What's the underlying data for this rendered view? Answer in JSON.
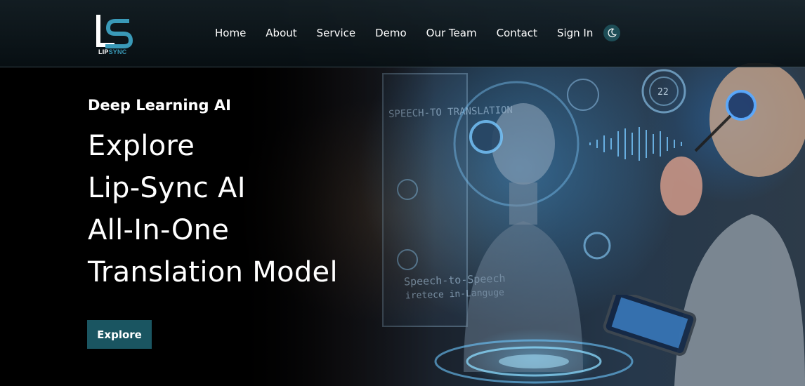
{
  "brand": {
    "logo_text_prefix": "LIP",
    "logo_text_accent": "SYNC",
    "logo_icon": "ls-monogram-icon",
    "accent_color": "#3a9ab8"
  },
  "nav": {
    "items": [
      {
        "label": "Home"
      },
      {
        "label": "About"
      },
      {
        "label": "Service"
      },
      {
        "label": "Demo"
      },
      {
        "label": "Our Team"
      },
      {
        "label": "Contact"
      },
      {
        "label": "Sign In"
      }
    ],
    "theme_toggle_icon": "moon-icon"
  },
  "hero": {
    "kicker": "Deep Learning AI",
    "headline_lines": [
      "Explore",
      "Lip-Sync AI",
      "All-In-One",
      "Translation Model"
    ],
    "cta_label": "Explore",
    "cta_color": "#1a5561",
    "image_text": {
      "panel_top": "SPEECH-TO TRANSLATION",
      "panel_bottom_1": "Speech-to-Speech",
      "panel_bottom_2": "iretece in-Languge",
      "badge": "22"
    }
  }
}
